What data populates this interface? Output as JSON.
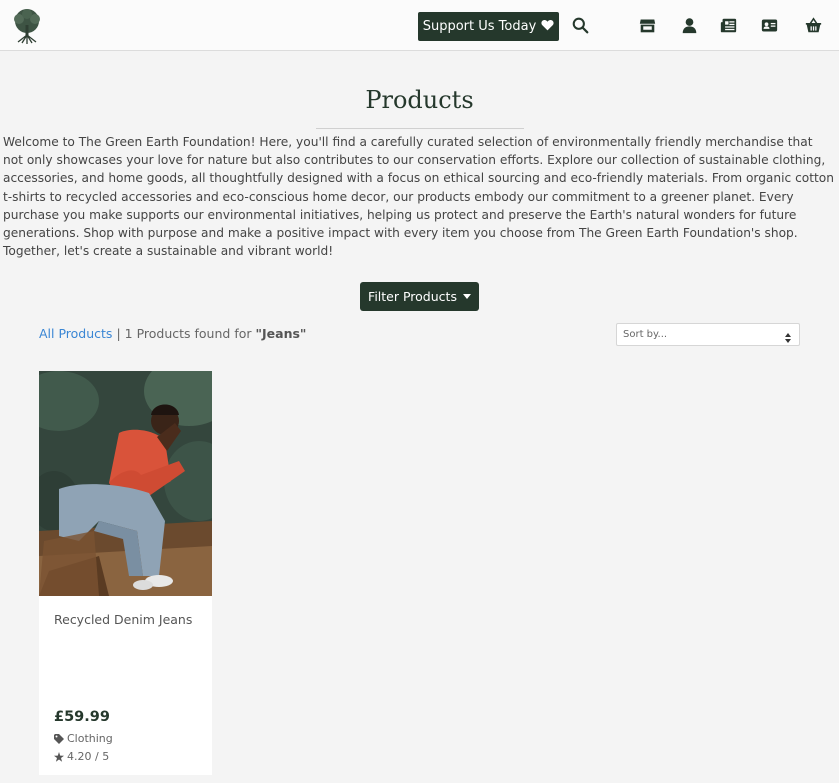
{
  "nav": {
    "support_label": "Support Us Today",
    "icons": [
      "tree-logo",
      "heart-icon",
      "search-icon",
      "store-icon",
      "user-icon",
      "newspaper-icon",
      "contact-card-icon",
      "basket-icon"
    ]
  },
  "page": {
    "title": "Products",
    "intro": "Welcome to The Green Earth Foundation! Here, you'll find a carefully curated selection of environmentally friendly merchandise that not only showcases your love for nature but also contributes to our conservation efforts. Explore our collection of sustainable clothing, accessories, and home goods, all thoughtfully designed with a focus on ethical sourcing and eco-friendly materials. From organic cotton t-shirts to recycled accessories and eco-conscious home decor, our products embody our commitment to a greener planet. Every purchase you make supports our environmental initiatives, helping us protect and preserve the Earth's natural wonders for future generations. Shop with purpose and make a positive impact with every item you choose from The Green Earth Foundation's shop. Together, let's create a sustainable and vibrant world!"
  },
  "filter": {
    "label": "Filter Products"
  },
  "results": {
    "all_link": "All Products",
    "separator": "|",
    "count_text": "1 Products found for",
    "query": "\"Jeans\""
  },
  "sort": {
    "placeholder": "Sort by..."
  },
  "products": [
    {
      "name": "Recycled Denim Jeans",
      "price": "£59.99",
      "category": "Clothing",
      "rating": "4.20 / 5"
    }
  ],
  "colors": {
    "brand_dark_green": "#25382c",
    "link_blue": "#3a86d4",
    "page_bg": "#f4f4f4"
  }
}
